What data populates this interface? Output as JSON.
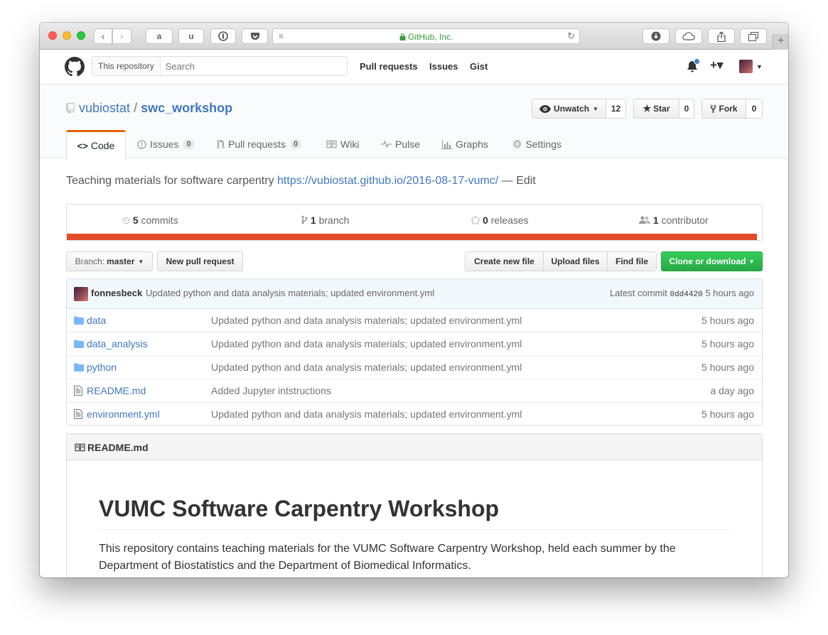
{
  "browser": {
    "url": "GitHub, Inc.",
    "new_tab": "+"
  },
  "header": {
    "scope_label": "This repository",
    "search_placeholder": "Search",
    "nav": [
      "Pull requests",
      "Issues",
      "Gist"
    ],
    "plus": "+▾"
  },
  "repo": {
    "owner": "vubiostat",
    "separator": "/",
    "name": "swc_workshop",
    "unwatch_label": "Unwatch",
    "watch_count": "12",
    "star_label": "Star",
    "star_count": "0",
    "fork_label": "Fork",
    "fork_count": "0"
  },
  "tabs": [
    {
      "label": "Code",
      "count": null
    },
    {
      "label": "Issues",
      "count": "0"
    },
    {
      "label": "Pull requests",
      "count": "0"
    },
    {
      "label": "Wiki",
      "count": null
    },
    {
      "label": "Pulse",
      "count": null
    },
    {
      "label": "Graphs",
      "count": null
    },
    {
      "label": "Settings",
      "count": null
    }
  ],
  "description": {
    "text": "Teaching materials for software carpentry",
    "link": "https://vubiostat.github.io/2016-08-17-vumc/",
    "edit": "— Edit"
  },
  "stats": {
    "commits_num": "5",
    "commits_label": "commits",
    "branch_num": "1",
    "branch_label": "branch",
    "releases_num": "0",
    "releases_label": "releases",
    "contributor_num": "1",
    "contributor_label": "contributor"
  },
  "language_color": "#e34c26",
  "toolbar": {
    "branch_prefix": "Branch:",
    "branch_name": "master",
    "new_pr": "New pull request",
    "create_file": "Create new file",
    "upload_files": "Upload files",
    "find_file": "Find file",
    "clone": "Clone or download"
  },
  "latest_commit": {
    "author": "fonnesbeck",
    "message": "Updated python and data analysis materials; updated environment.yml",
    "prefix": "Latest commit",
    "sha": "0dd4420",
    "age": "5 hours ago"
  },
  "files": [
    {
      "type": "folder",
      "name": "data",
      "message": "Updated python and data analysis materials; updated environment.yml",
      "age": "5 hours ago"
    },
    {
      "type": "folder",
      "name": "data_analysis",
      "message": "Updated python and data analysis materials; updated environment.yml",
      "age": "5 hours ago"
    },
    {
      "type": "folder",
      "name": "python",
      "message": "Updated python and data analysis materials; updated environment.yml",
      "age": "5 hours ago"
    },
    {
      "type": "file",
      "name": "README.md",
      "message": "Added Jupyter intstructions",
      "age": "a day ago"
    },
    {
      "type": "file",
      "name": "environment.yml",
      "message": "Updated python and data analysis materials; updated environment.yml",
      "age": "5 hours ago"
    }
  ],
  "readme": {
    "filename": "README.md",
    "heading": "VUMC Software Carpentry Workshop",
    "paragraph": "This repository contains teaching materials for the VUMC Software Carpentry Workshop, held each summer by the Department of Biostatistics and the Department of Biomedical Informatics."
  }
}
